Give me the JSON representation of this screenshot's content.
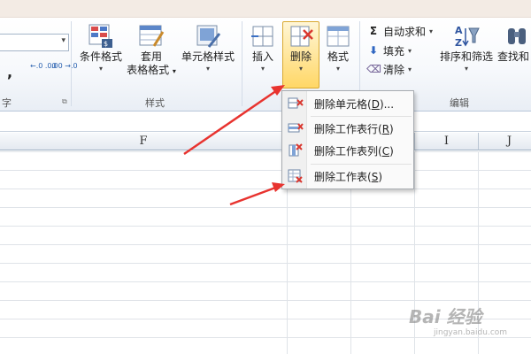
{
  "ribbon": {
    "comma_symbol": ",",
    "inc_decimal": "←.0 .00",
    "dec_decimal": ".00 →.0",
    "number_group_label": "字",
    "conditional_format_label": "条件格式",
    "table_format_label_1": "套用",
    "table_format_label_2": "表格格式",
    "cell_style_label": "单元格样式",
    "styles_group_label": "样式",
    "insert_label": "插入",
    "delete_label": "删除",
    "format_label": "格式",
    "autosum_label": "自动求和",
    "fill_label": "填充",
    "clear_label": "清除",
    "sort_filter_label": "排序和筛选",
    "find_label": "查找和",
    "editing_group_label": "编辑",
    "dropdown_glyph": "▾"
  },
  "columns": {
    "f": "F",
    "i": "I",
    "j": "J"
  },
  "delete_menu": {
    "items": [
      {
        "label": "删除单元格(",
        "key": "D",
        "suffix": ")..."
      },
      {
        "label": "删除工作表行(",
        "key": "R",
        "suffix": ")"
      },
      {
        "label": "删除工作表列(",
        "key": "C",
        "suffix": ")"
      },
      {
        "label": "删除工作表(",
        "key": "S",
        "suffix": ")"
      }
    ]
  },
  "watermark": {
    "main": "Bai 经验",
    "sub": "jingyan.baidu.com"
  },
  "colors": {
    "arrow": "#e8332f",
    "ribbon_bg": "#f4f7fb",
    "delete_highlight": "#ffd766"
  }
}
